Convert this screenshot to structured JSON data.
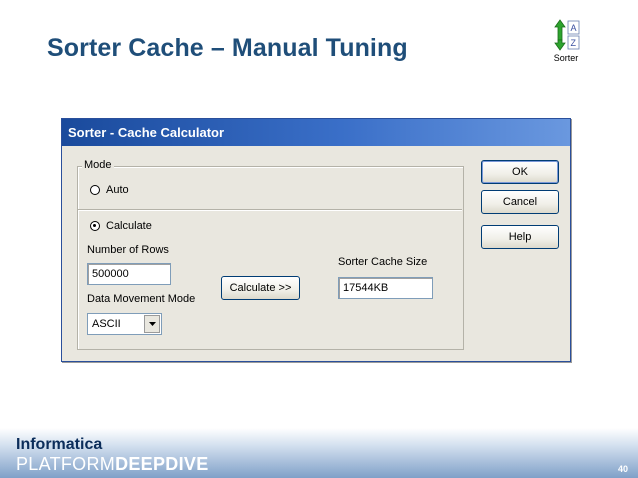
{
  "slide": {
    "title": "Sorter Cache – Manual Tuning"
  },
  "sorter_badge": {
    "icon": "sorter-az-icon",
    "label": "Sorter"
  },
  "dialog": {
    "title": "Sorter - Cache Calculator",
    "mode": {
      "legend": "Mode",
      "auto_label": "Auto",
      "calculate_label": "Calculate",
      "selected": "Calculate"
    },
    "rows": {
      "label": "Number of Rows",
      "value": "500000"
    },
    "movement": {
      "label": "Data Movement Mode",
      "value": "ASCII"
    },
    "calculate_button": "Calculate >>",
    "cache": {
      "label": "Sorter Cache Size",
      "value": "17544KB"
    },
    "buttons": {
      "ok": "OK",
      "cancel": "Cancel",
      "help": "Help"
    }
  },
  "footer": {
    "brand_line1": "Informatica",
    "brand_line2a": "PLATFORM",
    "brand_line2b": "DEEPDIVE",
    "page_number": "40"
  },
  "colors": {
    "title_blue": "#1f4e79",
    "titlebar_blue": "#1a4a9c",
    "dialog_face": "#e9e7df"
  }
}
